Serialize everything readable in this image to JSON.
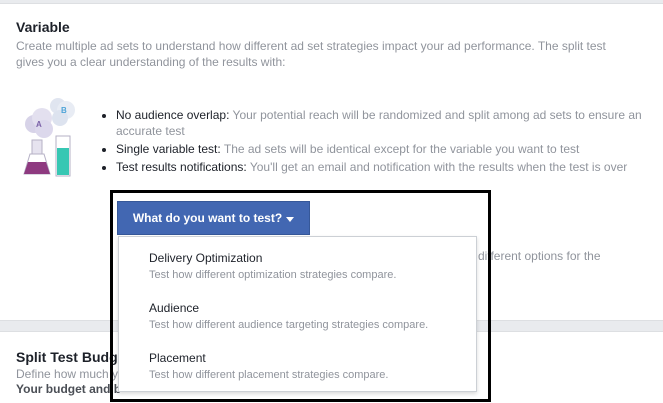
{
  "variable": {
    "title": "Variable",
    "description": "Create multiple ad sets to understand how different ad set strategies impact your ad performance. The split test gives you a clear understanding of the results with:"
  },
  "bullets": [
    {
      "label": "No audience overlap:",
      "text": "Your potential reach will be randomized and split among ad sets to ensure an accurate test"
    },
    {
      "label": "Single variable test:",
      "text": "The ad sets will be identical except for the variable you want to test"
    },
    {
      "label": "Test results notifications:",
      "text": "You'll get an email and notification with the results when the test is over"
    }
  ],
  "dropdown": {
    "label": "What do you want to test?",
    "items": [
      {
        "title": "Delivery Optimization",
        "description": "Test how different optimization strategies compare."
      },
      {
        "title": "Audience",
        "description": "Test how different audience targeting strategies compare."
      },
      {
        "title": "Placement",
        "description": "Test how different placement strategies compare."
      }
    ]
  },
  "side_text": "different options for the",
  "budget": {
    "title": "Split Test Budg",
    "description": "Define how much y",
    "description2": "Your budget and b"
  },
  "illustration": {
    "bubble_a": "A",
    "bubble_b": "B"
  },
  "colors": {
    "button": "#4267b2",
    "purple": "#8e3a80",
    "teal": "#37c7b3"
  }
}
